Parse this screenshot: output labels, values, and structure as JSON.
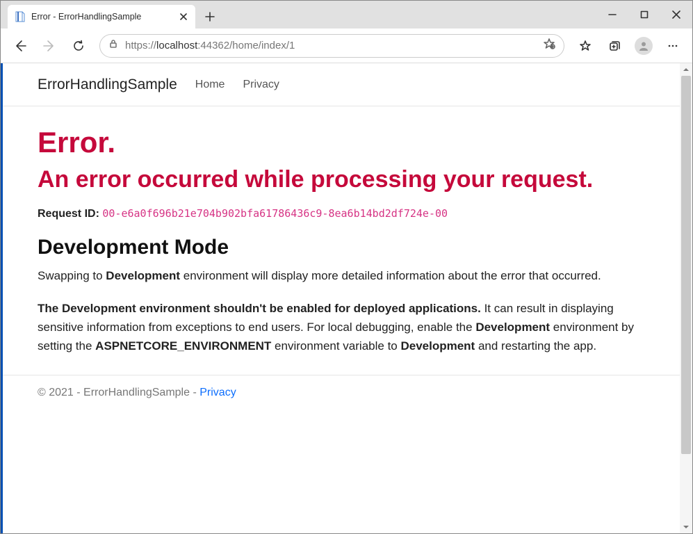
{
  "browser": {
    "tab_title": "Error - ErrorHandlingSample",
    "url_scheme": "https://",
    "url_host": "localhost",
    "url_rest": ":44362/home/index/1"
  },
  "nav": {
    "brand": "ErrorHandlingSample",
    "home": "Home",
    "privacy": "Privacy"
  },
  "error": {
    "title": "Error.",
    "subtitle": "An error occurred while processing your request.",
    "request_id_label": "Request ID:",
    "request_id_value": "00-e6a0f696b21e704b902bfa61786436c9-8ea6b14bd2df724e-00"
  },
  "dev": {
    "heading": "Development Mode",
    "p1_a": "Swapping to ",
    "p1_b": "Development",
    "p1_c": " environment will display more detailed information about the error that occurred.",
    "p2_a": "The Development environment shouldn't be enabled for deployed applications.",
    "p2_b": " It can result in displaying sensitive information from exceptions to end users. For local debugging, enable the ",
    "p2_c": "Development",
    "p2_d": " environment by setting the ",
    "p2_e": "ASPNETCORE_ENVIRONMENT",
    "p2_f": " environment variable to ",
    "p2_g": "Development",
    "p2_h": " and restarting the app."
  },
  "footer": {
    "copyright": "© 2021 - ErrorHandlingSample - ",
    "privacy": "Privacy"
  }
}
